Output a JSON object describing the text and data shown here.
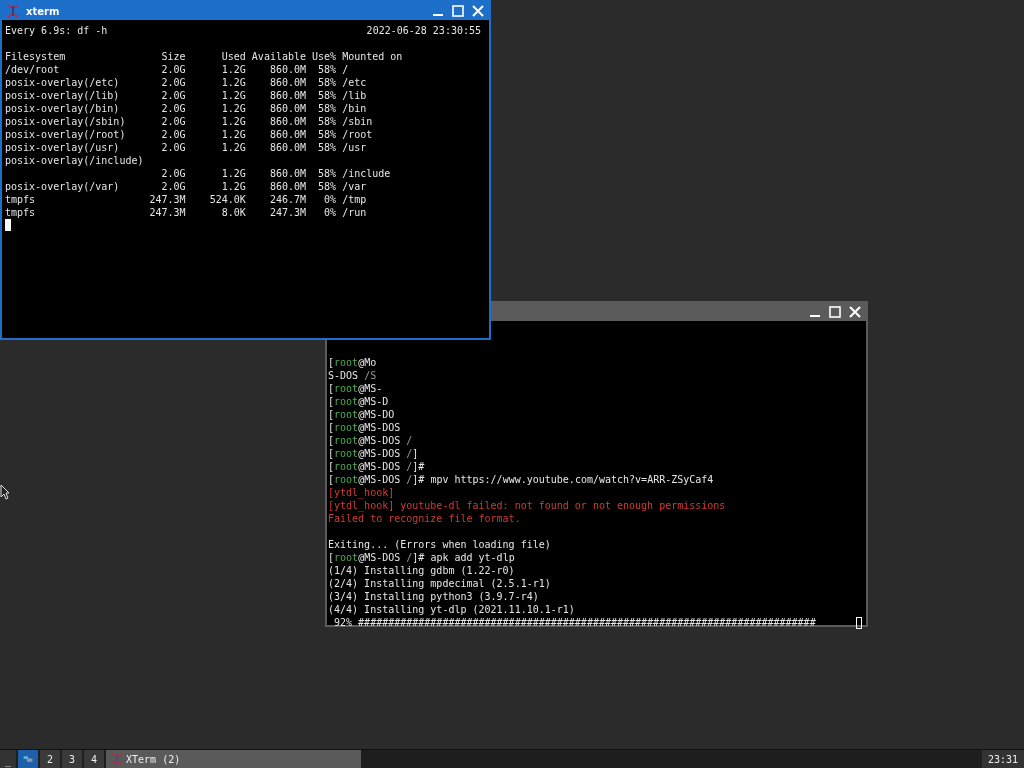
{
  "xterm_window": {
    "title": "xterm",
    "focused": true,
    "command": "Every 6.9s: df -h",
    "timestamp": "2022-06-28 23:30:55",
    "lines": [
      "Filesystem                Size      Used Available Use% Mounted on",
      "/dev/root                 2.0G      1.2G    860.0M  58% /",
      "posix-overlay(/etc)       2.0G      1.2G    860.0M  58% /etc",
      "posix-overlay(/lib)       2.0G      1.2G    860.0M  58% /lib",
      "posix-overlay(/bin)       2.0G      1.2G    860.0M  58% /bin",
      "posix-overlay(/sbin)      2.0G      1.2G    860.0M  58% /sbin",
      "posix-overlay(/root)      2.0G      1.2G    860.0M  58% /root",
      "posix-overlay(/usr)       2.0G      1.2G    860.0M  58% /usr",
      "posix-overlay(/include)",
      "                          2.0G      1.2G    860.0M  58% /include",
      "posix-overlay(/var)       2.0G      1.2G    860.0M  58% /var",
      "tmpfs                   247.3M    524.0K    246.7M   0% /tmp",
      "tmpfs                   247.3M      8.0K    247.3M   0% /run"
    ]
  },
  "background_terminal": {
    "focused": false,
    "blocks": [
      [
        {
          "segments": [
            {
              "text": "[",
              "kind": "plain"
            },
            {
              "text": "root",
              "kind": "user"
            },
            {
              "text": "@Mo",
              "kind": "plain"
            }
          ]
        },
        {
          "segments": [
            {
              "text": "S-DOS",
              "kind": "plain"
            },
            {
              "text": " /S",
              "kind": "path"
            }
          ]
        },
        {
          "segments": [
            {
              "text": "[",
              "kind": "plain"
            },
            {
              "text": "root",
              "kind": "user"
            },
            {
              "text": "@MS-",
              "kind": "plain"
            }
          ]
        },
        {
          "segments": [
            {
              "text": "[",
              "kind": "plain"
            },
            {
              "text": "root",
              "kind": "user"
            },
            {
              "text": "@MS-D",
              "kind": "plain"
            }
          ]
        },
        {
          "segments": [
            {
              "text": "[",
              "kind": "plain"
            },
            {
              "text": "root",
              "kind": "user"
            },
            {
              "text": "@MS-DO",
              "kind": "plain"
            }
          ]
        },
        {
          "segments": [
            {
              "text": "[",
              "kind": "plain"
            },
            {
              "text": "root",
              "kind": "user"
            },
            {
              "text": "@MS-DOS",
              "kind": "plain"
            }
          ]
        },
        {
          "segments": [
            {
              "text": "[",
              "kind": "plain"
            },
            {
              "text": "root",
              "kind": "user"
            },
            {
              "text": "@MS-DOS",
              "kind": "plain"
            },
            {
              "text": " /",
              "kind": "path"
            }
          ]
        },
        {
          "segments": [
            {
              "text": "[",
              "kind": "plain"
            },
            {
              "text": "root",
              "kind": "user"
            },
            {
              "text": "@MS-DOS",
              "kind": "plain"
            },
            {
              "text": " /",
              "kind": "path"
            },
            {
              "text": "]",
              "kind": "plain"
            }
          ]
        },
        {
          "segments": [
            {
              "text": "[",
              "kind": "plain"
            },
            {
              "text": "root",
              "kind": "user"
            },
            {
              "text": "@MS-DOS",
              "kind": "plain"
            },
            {
              "text": " /",
              "kind": "path"
            },
            {
              "text": "]#",
              "kind": "plain"
            }
          ]
        },
        {
          "segments": [
            {
              "text": "[",
              "kind": "plain"
            },
            {
              "text": "root",
              "kind": "user"
            },
            {
              "text": "@MS-DOS",
              "kind": "plain"
            },
            {
              "text": " /",
              "kind": "path"
            },
            {
              "text": "]# mpv https://www.youtube.com/watch?v=ARR-ZSyCaf4",
              "kind": "plain"
            }
          ]
        },
        {
          "segments": [
            {
              "text": "[ytdl_hook]",
              "kind": "error"
            }
          ]
        },
        {
          "segments": [
            {
              "text": "[ytdl_hook] youtube-dl failed: not found or not enough permissions",
              "kind": "error"
            }
          ]
        },
        {
          "segments": [
            {
              "text": "Failed to recognize file format.",
              "kind": "error"
            }
          ]
        }
      ],
      [
        {
          "segments": [
            {
              "text": "Exiting... (Errors when loading file)",
              "kind": "plain"
            }
          ]
        },
        {
          "segments": [
            {
              "text": "[",
              "kind": "plain"
            },
            {
              "text": "root",
              "kind": "user"
            },
            {
              "text": "@MS-DOS",
              "kind": "plain"
            },
            {
              "text": " /",
              "kind": "path"
            },
            {
              "text": "]# apk add yt-dlp",
              "kind": "plain"
            }
          ]
        },
        {
          "segments": [
            {
              "text": "(1/4) Installing gdbm (1.22-r0)",
              "kind": "plain"
            }
          ]
        },
        {
          "segments": [
            {
              "text": "(2/4) Installing mpdecimal (2.5.1-r1)",
              "kind": "plain"
            }
          ]
        },
        {
          "segments": [
            {
              "text": "(3/4) Installing python3 (3.9.7-r4)",
              "kind": "plain"
            }
          ]
        },
        {
          "segments": [
            {
              "text": "(4/4) Installing yt-dlp (2021.11.10.1-r1)",
              "kind": "plain"
            }
          ]
        }
      ]
    ],
    "progress_line": " 92% ############################################################################"
  },
  "taskbar": {
    "menu_button": "_",
    "desktops": [
      {
        "selected": true
      },
      {
        "label": "2",
        "selected": false
      },
      {
        "label": "3",
        "selected": false
      },
      {
        "label": "4",
        "selected": false
      }
    ],
    "tasks": [
      {
        "label": "XTerm (2)"
      }
    ],
    "clock": "23:31"
  }
}
